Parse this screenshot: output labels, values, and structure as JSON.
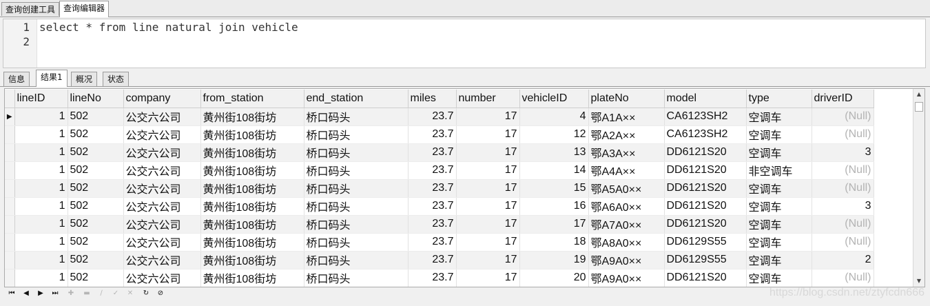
{
  "top_tabs": [
    "查询创建工具",
    "查询编辑器"
  ],
  "editor": {
    "lines": [
      {
        "num": "1",
        "text": "select * from line natural join vehicle"
      },
      {
        "num": "2",
        "text": ""
      }
    ]
  },
  "result_tabs": [
    "信息",
    "结果1",
    "概况",
    "状态"
  ],
  "grid": {
    "columns": [
      "lineID",
      "lineNo",
      "company",
      "from_station",
      "end_station",
      "miles",
      "number",
      "vehicleID",
      "plateNo",
      "model",
      "type",
      "driverID"
    ],
    "rows": [
      [
        "1",
        "502",
        "公交六公司",
        "黄州街108街坊",
        "桥口码头",
        "23.7",
        "17",
        "4",
        "鄂A1A××",
        "CA6123SH2",
        "空调车",
        "(Null)"
      ],
      [
        "1",
        "502",
        "公交六公司",
        "黄州街108街坊",
        "桥口码头",
        "23.7",
        "17",
        "12",
        "鄂A2A××",
        "CA6123SH2",
        "空调车",
        "(Null)"
      ],
      [
        "1",
        "502",
        "公交六公司",
        "黄州街108街坊",
        "桥口码头",
        "23.7",
        "17",
        "13",
        "鄂A3A××",
        "DD6121S20",
        "空调车",
        "3"
      ],
      [
        "1",
        "502",
        "公交六公司",
        "黄州街108街坊",
        "桥口码头",
        "23.7",
        "17",
        "14",
        "鄂A4A××",
        "DD6121S20",
        "非空调车",
        "(Null)"
      ],
      [
        "1",
        "502",
        "公交六公司",
        "黄州街108街坊",
        "桥口码头",
        "23.7",
        "17",
        "15",
        "鄂A5A0××",
        "DD6121S20",
        "空调车",
        "(Null)"
      ],
      [
        "1",
        "502",
        "公交六公司",
        "黄州街108街坊",
        "桥口码头",
        "23.7",
        "17",
        "16",
        "鄂A6A0××",
        "DD6121S20",
        "空调车",
        "3"
      ],
      [
        "1",
        "502",
        "公交六公司",
        "黄州街108街坊",
        "桥口码头",
        "23.7",
        "17",
        "17",
        "鄂A7A0××",
        "DD6121S20",
        "空调车",
        "(Null)"
      ],
      [
        "1",
        "502",
        "公交六公司",
        "黄州街108街坊",
        "桥口码头",
        "23.7",
        "17",
        "18",
        "鄂A8A0××",
        "DD6129S55",
        "空调车",
        "(Null)"
      ],
      [
        "1",
        "502",
        "公交六公司",
        "黄州街108街坊",
        "桥口码头",
        "23.7",
        "17",
        "19",
        "鄂A9A0××",
        "DD6129S55",
        "空调车",
        "2"
      ],
      [
        "1",
        "502",
        "公交六公司",
        "黄州街108街坊",
        "桥口码头",
        "23.7",
        "17",
        "20",
        "鄂A9A0××",
        "DD6121S20",
        "空调车",
        "(Null)"
      ]
    ],
    "current_row_marker": "▶"
  },
  "navbar": {
    "buttons": [
      {
        "icon": "first-record-icon",
        "glyph": "⏮",
        "enabled": true
      },
      {
        "icon": "prev-record-icon",
        "glyph": "◀",
        "enabled": true
      },
      {
        "icon": "next-record-icon",
        "glyph": "▶",
        "enabled": true
      },
      {
        "icon": "last-record-icon",
        "glyph": "⏭",
        "enabled": true
      },
      {
        "icon": "add-record-icon",
        "glyph": "✚",
        "enabled": false
      },
      {
        "icon": "delete-record-icon",
        "glyph": "▬",
        "enabled": false
      },
      {
        "icon": "edit-record-icon",
        "glyph": "∕",
        "enabled": false
      },
      {
        "icon": "apply-changes-icon",
        "glyph": "✓",
        "enabled": false
      },
      {
        "icon": "cancel-changes-icon",
        "glyph": "✕",
        "enabled": false
      },
      {
        "icon": "refresh-icon",
        "glyph": "↻",
        "enabled": true
      },
      {
        "icon": "stop-icon",
        "glyph": "⊘",
        "enabled": true
      }
    ]
  },
  "watermark": "https://blog.csdn.net/ztyfcdn666",
  "colors": {
    "null_text": "#b3b3b3",
    "alt_row": "#f2f2f2",
    "header_bg": "#f1f1f1"
  }
}
